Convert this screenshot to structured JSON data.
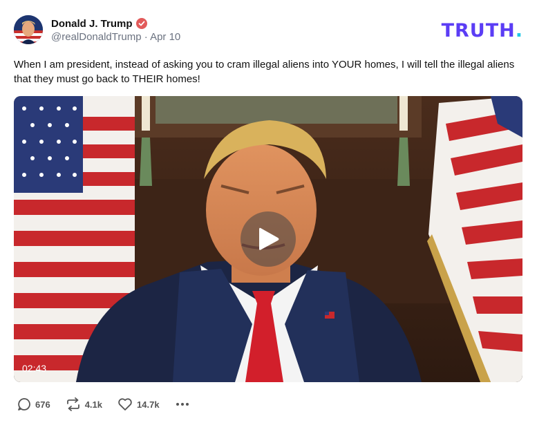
{
  "author": {
    "name": "Donald J. Trump",
    "handle": "@realDonaldTrump",
    "separator": "·",
    "date": "Apr 10",
    "verified_color": "#e25a5a"
  },
  "brand": {
    "text": "TRUTH",
    "dot": ".",
    "color": "#5b3df5",
    "dot_color": "#21c8e6"
  },
  "post": {
    "text": "When I am president, instead of asking you to cram illegal aliens into YOUR homes, I will tell the illegal aliens that they must go back to THEIR homes!"
  },
  "video": {
    "duration": "02:43",
    "play_icon": "play-icon"
  },
  "actions": {
    "replies": "676",
    "retruths": "4.1k",
    "likes": "14.7k"
  }
}
